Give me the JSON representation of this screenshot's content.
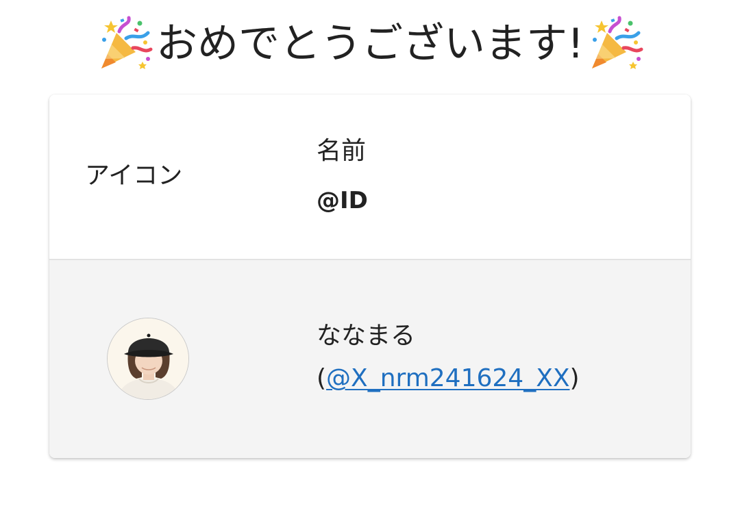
{
  "title": {
    "text": "おめでとうございます!",
    "left_emoji": "party-popper-icon",
    "right_emoji": "party-popper-icon"
  },
  "table": {
    "headers": {
      "icon": "アイコン",
      "name": "名前",
      "id": "@ID"
    },
    "rows": [
      {
        "avatar": "user-avatar",
        "name": "ななまる",
        "handle_open": "(",
        "handle": "@X_nrm241624_XX",
        "handle_close": ")"
      }
    ]
  },
  "colors": {
    "link": "#1f6fc0",
    "row_background": "#f4f4f4",
    "header_background": "#ffffff"
  }
}
